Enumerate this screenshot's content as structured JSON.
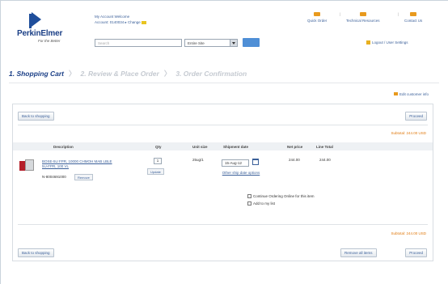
{
  "header": {
    "brand": "PerkinElmer",
    "brand_tag": "For the Better",
    "account_line1": "My Account  Welcome",
    "account_line2": "Account: 0140034 ▸ Change",
    "search_placeholder": "Search",
    "search_scope": "Entire Site",
    "top_links": [
      "Quick Order",
      "Technical Resources",
      "Contact Us"
    ],
    "login": "Logout / User Settings"
  },
  "steps": {
    "step1": "1. Shopping Cart",
    "step2": "2. Review & Place Order",
    "step3": "3. Order Confirmation"
  },
  "cart": {
    "edit_link": "Edit customer info",
    "back_label": "Back to shopping",
    "proceed_label": "Proceed",
    "remove_all_label": "Remove all items",
    "subtotal": "Subtotal: 244.00 USD",
    "columns": [
      "Description",
      "Qty",
      "Unit size",
      "Shipment date",
      "Net price",
      "Line Total"
    ],
    "item": {
      "name": "BOSE-5U FPR, 10000 CHMOH MAB LBLE 5U-FPR, 100 VL",
      "part_no": "N-8004691000",
      "remove_label": "Remove",
      "qty": "1",
      "update_label": "Update",
      "unit_size": "25ug/1",
      "ship_date": "15-Aug-12",
      "ship_link": "Other ship date options",
      "net_price": "244.00",
      "line_total": "244.00",
      "option1": "Continue Ordering Online for this item",
      "option1_link": "Ordering Online",
      "option2": "Add to my list",
      "option2_link": "my list"
    }
  }
}
